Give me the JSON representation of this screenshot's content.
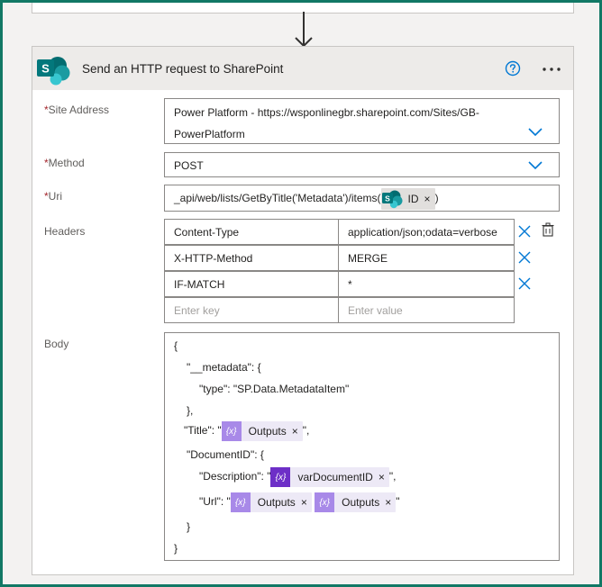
{
  "action": {
    "title": "Send an HTTP request to SharePoint",
    "logo_letter": "S"
  },
  "fields": {
    "site_address": {
      "label": "Site Address",
      "required_mark": "*",
      "value_line1": "Power Platform - https://wsponlinegbr.sharepoint.com/Sites/GB-",
      "value_line2": "PowerPlatform"
    },
    "method": {
      "label": "Method",
      "required_mark": "*",
      "value": "POST"
    },
    "uri": {
      "label": "Uri",
      "required_mark": "*",
      "prefix": "_api/web/lists/GetByTitle('Metadata')/items(",
      "token_label": "ID",
      "token_close": "×",
      "suffix": ")"
    },
    "headers": {
      "label": "Headers",
      "rows": [
        {
          "key": "Content-Type",
          "value": "application/json;odata=verbose"
        },
        {
          "key": "X-HTTP-Method",
          "value": "MERGE"
        },
        {
          "key": "IF-MATCH",
          "value": "*"
        }
      ],
      "key_placeholder": "Enter key",
      "value_placeholder": "Enter value"
    },
    "body": {
      "label": "Body",
      "line1": "{",
      "line2": "\"__metadata\": {",
      "line3": "\"type\": \"SP.Data.MetadataItem\"",
      "line4": "},",
      "line5_prefix": "\"Title\": \"",
      "line5_suffix": "\",",
      "line6": "\"DocumentID\": {",
      "line7_prefix": "\"Description\": \"",
      "line7_suffix": "\",",
      "line8_prefix": "\"Url\": \"",
      "line8_suffix": "\"",
      "line9": "}",
      "line10": "}",
      "tokens": {
        "title_outputs": "Outputs",
        "description_var": "varDocumentID",
        "url_outputs_1": "Outputs",
        "url_outputs_2": "Outputs",
        "close": "×",
        "expr_icon": "{x}"
      }
    }
  },
  "icons": {
    "help": "help-circle-icon",
    "more": "ellipsis-icon",
    "chevron": "chevron-down-icon",
    "remove": "close-icon",
    "trash": "delete-icon",
    "arrow": "arrow-down-icon"
  },
  "colors": {
    "frame": "#117865",
    "sharepoint": "#038387",
    "accent": "#0078d4",
    "expression": "#a889e8",
    "variable": "#6d2fc7",
    "required": "#a4262c"
  }
}
